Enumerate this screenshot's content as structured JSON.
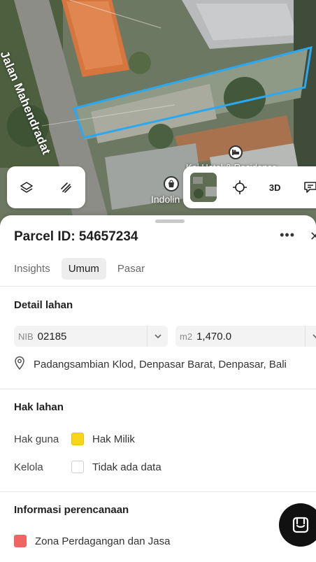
{
  "map": {
    "road_label": "Jalan Mahendradat",
    "poi_indolin": "Indolin",
    "poi_hotel": "Koi Hotel & Residence",
    "parcel_outline_color": "#2aa8f2",
    "controls_left": [
      {
        "icon": "layers-icon"
      },
      {
        "icon": "measure-icon"
      }
    ],
    "controls_right": {
      "thumbnail": "satellite-thumbnail",
      "locate_icon": "crosshair-icon",
      "btn_3d": "3D",
      "chat_icon": "message-icon"
    }
  },
  "sheet": {
    "title": "Parcel ID: 54657234",
    "more_icon": "•••",
    "close_icon": "✕",
    "tabs": [
      {
        "label": "Insights",
        "active": false
      },
      {
        "label": "Umum",
        "active": true
      },
      {
        "label": "Pasar",
        "active": false
      }
    ],
    "detail": {
      "title": "Detail lahan",
      "nib_prefix": "NIB",
      "nib_value": "02185",
      "area_prefix": "m2",
      "area_value": "1,470.0",
      "address": "Padangsambian Klod, Denpasar Barat, Denpasar, Bali"
    },
    "hak": {
      "title": "Hak lahan",
      "rows": [
        {
          "label": "Hak guna",
          "value": "Hak Milik",
          "color": "#f7d51d"
        },
        {
          "label": "Kelola",
          "value": "Tidak ada data",
          "color": ""
        }
      ]
    },
    "planning": {
      "title": "Informasi perencanaan",
      "zone": "Zona Perdagangan dan Jasa",
      "zone_color": "#f06464"
    }
  }
}
